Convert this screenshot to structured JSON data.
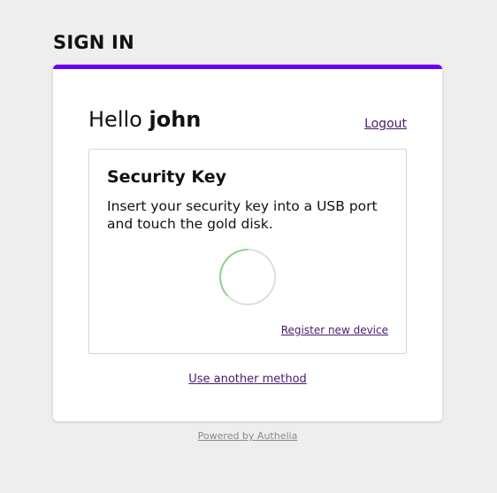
{
  "page_title": "SIGN IN",
  "accent_color": "#6a00f4",
  "link_color": "#4a1a6a",
  "greeting": {
    "prefix": "Hello",
    "username": "john"
  },
  "logout_label": "Logout",
  "method": {
    "title": "Security Key",
    "description": "Insert your security key into a USB port and touch the gold disk.",
    "spinner_icon": "loading-spinner-icon",
    "register_label": "Register new device"
  },
  "another_method_label": "Use another method",
  "footer_label": "Powered by Authelia"
}
